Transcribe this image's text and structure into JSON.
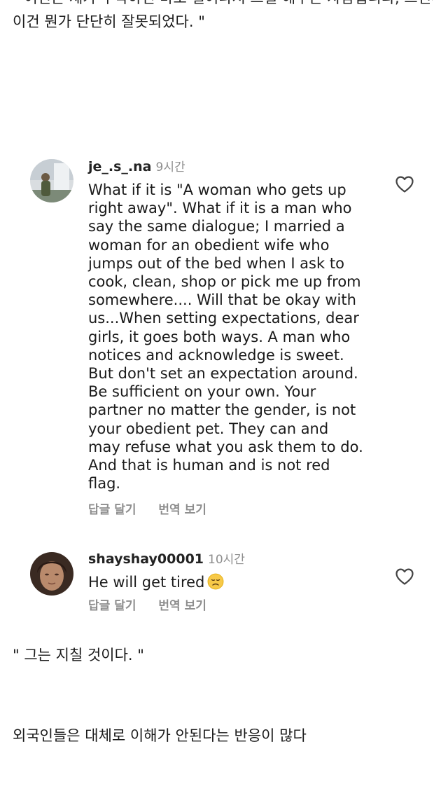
{
  "post": {
    "top_cut_line": "\" 여친은 제가 부탁하면 바로 일어나서 그걸 해주는 사람입니다, 그런데 이 반응이 ",
    "line2": "이건 뭔가 단단히 잘못되었다. \"",
    "translation_caption": "\" 그는 지칠 것이다. \"",
    "conclusion": "외국인들은 대체로 이해가 안된다는 반응이 많다"
  },
  "comments": [
    {
      "username": "je_.s_.na",
      "time": "9시간",
      "lines": [
        "What if it is \"A woman who gets up",
        "right away\". What if it is a man who",
        "say the same dialogue; I married a",
        "woman for an obedient wife who",
        "jumps out of the bed when I ask to",
        "cook, clean, shop or pick me up from",
        "somewhere.... Will that be okay with",
        "us...When setting expectations, dear",
        "girls, it goes both ways. A man who",
        "notices and acknowledge is sweet.",
        "But don't set an expectation around.",
        "Be sufficient on your own. Your",
        "partner no matter the gender, is not",
        "your obedient pet. They can and",
        "may refuse what you ask them to do.",
        "And that is human and is not red",
        "flag."
      ],
      "reply_label": "답글 달기",
      "translate_label": "번역 보기",
      "like_icon": "heart-outline-icon",
      "avatar_icon": "user-avatar-photo"
    },
    {
      "username": "shayshay00001",
      "time": "10시간",
      "text": "He will get tired",
      "emoji": "disappointed-face-emoji",
      "reply_label": "답글 달기",
      "translate_label": "번역 보기",
      "like_icon": "heart-outline-icon",
      "avatar_icon": "user-avatar-photo"
    }
  ],
  "colors": {
    "text": "#1a1a1a",
    "muted": "#8e8e8e",
    "background": "#ffffff"
  }
}
